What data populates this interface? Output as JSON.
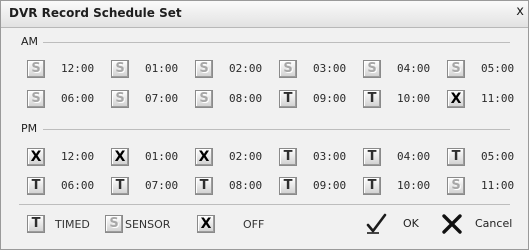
{
  "window": {
    "title": "DVR Record Schedule Set",
    "close_symbol": "x"
  },
  "am": {
    "label": "AM",
    "rows": [
      [
        {
          "mode": "S",
          "time": "12:00"
        },
        {
          "mode": "S",
          "time": "01:00"
        },
        {
          "mode": "S",
          "time": "02:00"
        },
        {
          "mode": "S",
          "time": "03:00"
        },
        {
          "mode": "S",
          "time": "04:00"
        },
        {
          "mode": "S",
          "time": "05:00"
        }
      ],
      [
        {
          "mode": "S",
          "time": "06:00"
        },
        {
          "mode": "S",
          "time": "07:00"
        },
        {
          "mode": "S",
          "time": "08:00"
        },
        {
          "mode": "T",
          "time": "09:00"
        },
        {
          "mode": "T",
          "time": "10:00"
        },
        {
          "mode": "X",
          "time": "11:00"
        }
      ]
    ]
  },
  "pm": {
    "label": "PM",
    "rows": [
      [
        {
          "mode": "X",
          "time": "12:00"
        },
        {
          "mode": "X",
          "time": "01:00"
        },
        {
          "mode": "X",
          "time": "02:00"
        },
        {
          "mode": "T",
          "time": "03:00"
        },
        {
          "mode": "T",
          "time": "04:00"
        },
        {
          "mode": "T",
          "time": "05:00"
        }
      ],
      [
        {
          "mode": "T",
          "time": "06:00"
        },
        {
          "mode": "T",
          "time": "07:00"
        },
        {
          "mode": "T",
          "time": "08:00"
        },
        {
          "mode": "T",
          "time": "09:00"
        },
        {
          "mode": "T",
          "time": "10:00"
        },
        {
          "mode": "S",
          "time": "11:00"
        }
      ]
    ]
  },
  "legend": [
    {
      "mode": "T",
      "label": "TIMED"
    },
    {
      "mode": "S",
      "label": "SENSOR"
    },
    {
      "mode": "X",
      "label": "OFF"
    }
  ],
  "mode_glyphs": {
    "T": "T",
    "S": "S",
    "X": "X"
  },
  "actions": {
    "ok": {
      "label": "OK",
      "icon": "checkmark-icon"
    },
    "cancel": {
      "label": "Cancel",
      "icon": "cross-icon"
    }
  }
}
